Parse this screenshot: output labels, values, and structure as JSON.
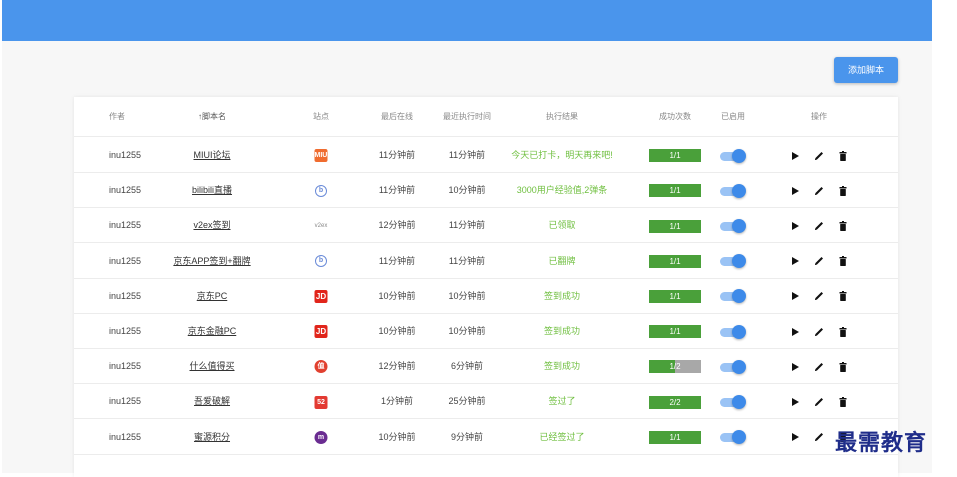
{
  "toolbar": {
    "add_script_label": "添加脚本"
  },
  "table": {
    "headers": {
      "author": "作者",
      "name": "↑脚本名",
      "site": "站点",
      "status": "最后在线",
      "last_run": "最近执行时间",
      "result": "执行结果",
      "success": "成功次数",
      "enabled": "已启用",
      "ops": "操作"
    },
    "rows": [
      {
        "author": "inu1255",
        "name": "MIUI论坛",
        "site_icon": "miui-icon",
        "site_text": "MIUI",
        "status": "11分钟前",
        "last_run": "11分钟前",
        "result": "今天已打卡，明天再来吧!",
        "success": "1/1",
        "enabled": true
      },
      {
        "author": "inu1255",
        "name": "bilibili直播",
        "site_icon": "bilibili-icon",
        "site_text": "b",
        "status": "11分钟前",
        "last_run": "10分钟前",
        "result": "3000用户经验值,2弹条",
        "success": "1/1",
        "enabled": true
      },
      {
        "author": "inu1255",
        "name": "v2ex签到",
        "site_icon": "v2ex-icon",
        "site_text": "v2ex",
        "status": "12分钟前",
        "last_run": "11分钟前",
        "result": "已领取",
        "success": "1/1",
        "enabled": true
      },
      {
        "author": "inu1255",
        "name": "京东APP签到+翻牌",
        "site_icon": "jd-app-icon",
        "site_text": "b",
        "status": "11分钟前",
        "last_run": "11分钟前",
        "result": "已翻牌",
        "success": "1/1",
        "enabled": true
      },
      {
        "author": "inu1255",
        "name": "京东PC",
        "site_icon": "jd-icon",
        "site_text": "JD",
        "status": "10分钟前",
        "last_run": "10分钟前",
        "result": "签到成功",
        "success": "1/1",
        "enabled": true
      },
      {
        "author": "inu1255",
        "name": "京东金融PC",
        "site_icon": "jd-finance-icon",
        "site_text": "JD",
        "status": "10分钟前",
        "last_run": "10分钟前",
        "result": "签到成功",
        "success": "1/1",
        "enabled": true
      },
      {
        "author": "inu1255",
        "name": "什么值得买",
        "site_icon": "smzdm-icon",
        "site_text": "值",
        "status": "12分钟前",
        "last_run": "6分钟前",
        "result": "签到成功",
        "success": "1/2",
        "enabled": true
      },
      {
        "author": "inu1255",
        "name": "吾爱破解",
        "site_icon": "52pojie-icon",
        "site_text": "52",
        "status": "1分钟前",
        "last_run": "25分钟前",
        "result": "签过了",
        "success": "2/2",
        "enabled": true
      },
      {
        "author": "inu1255",
        "name": "蜜源积分",
        "site_icon": "miyuan-icon",
        "site_text": "m",
        "status": "10分钟前",
        "last_run": "9分钟前",
        "result": "已经签过了",
        "success": "1/1",
        "enabled": true
      }
    ]
  },
  "watermark": "最需教育",
  "colors": {
    "header": "#4a95ec",
    "success_text": "#6fbf3f",
    "badge_green": "#4aa03a",
    "toggle_on": "#3d8ae9"
  }
}
